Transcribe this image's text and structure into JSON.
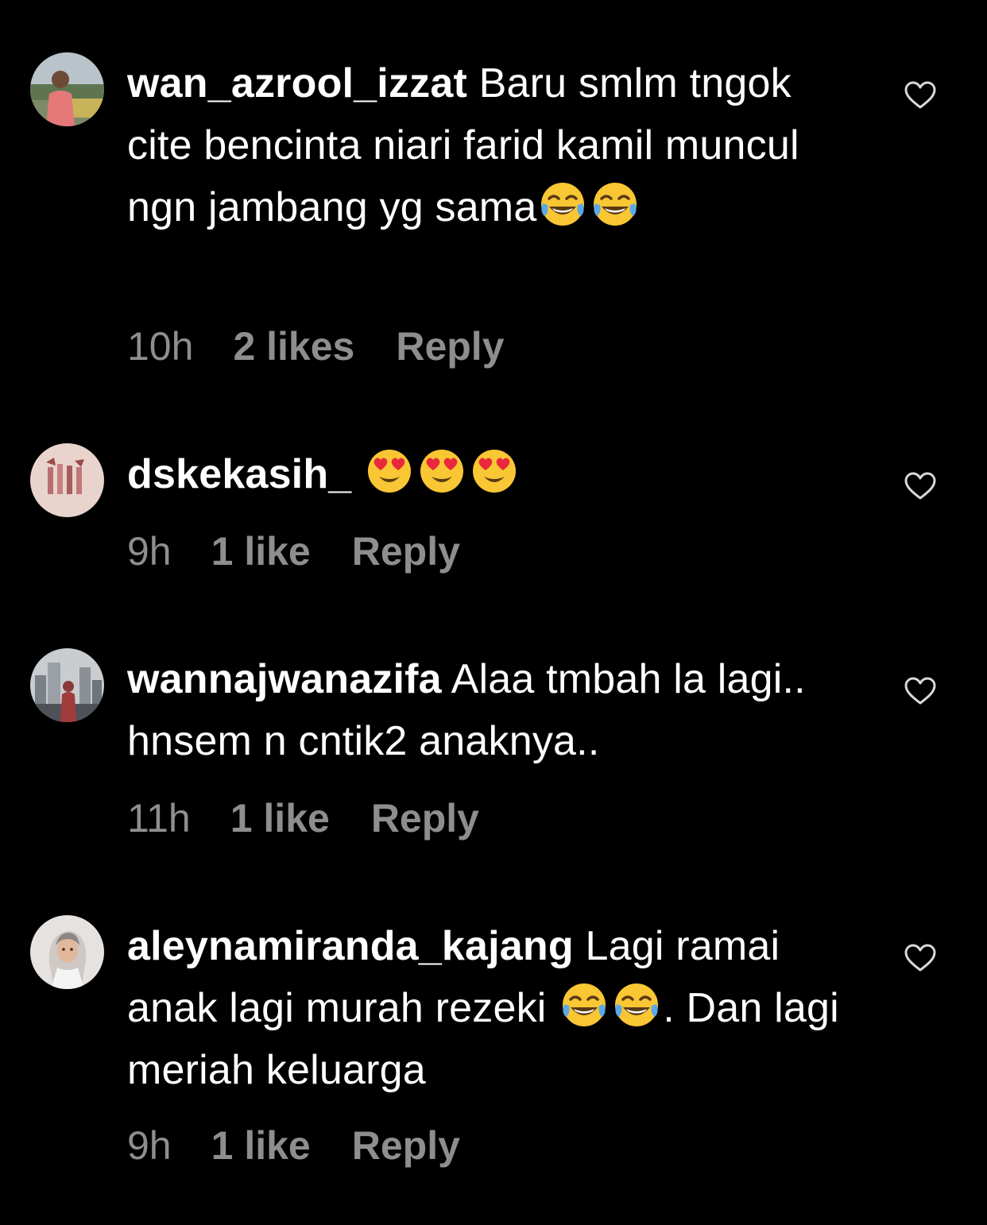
{
  "colors": {
    "background": "#000000",
    "text": "#ffffff",
    "meta_text": "#8e8e8e",
    "heart_outline": "#d8d8d8"
  },
  "comments": [
    {
      "username": "wan_azrool_izzat",
      "text_parts": [
        " Baru smlm tngok  cite bencinta niari farid kamil muncul ngn jambang yg sama"
      ],
      "emojis": [
        "face-with-tears-of-joy",
        "face-with-tears-of-joy"
      ],
      "time": "10h",
      "likes": "2 likes",
      "reply": "Reply",
      "like_icon": "heart-outline-icon"
    },
    {
      "username": "dskekasih_",
      "text_parts": [
        " "
      ],
      "emojis": [
        "smiling-face-with-heart-eyes",
        "smiling-face-with-heart-eyes",
        "smiling-face-with-heart-eyes"
      ],
      "time": "9h",
      "likes": "1 like",
      "reply": "Reply",
      "like_icon": "heart-outline-icon"
    },
    {
      "username": "wannajwanazifa",
      "text_parts": [
        " Alaa tmbah la lagi.. hnsem n cntik2 anaknya.."
      ],
      "emojis": [],
      "time": "11h",
      "likes": "1 like",
      "reply": "Reply",
      "like_icon": "heart-outline-icon"
    },
    {
      "username": "aleynamiranda_kajang",
      "text_parts": [
        " Lagi ramai anak lagi murah rezeki ",
        ". Dan lagi meriah keluarga"
      ],
      "emojis": [
        "face-with-tears-of-joy",
        "face-with-tears-of-joy"
      ],
      "time": "9h",
      "likes": "1 like",
      "reply": "Reply",
      "like_icon": "heart-outline-icon"
    }
  ]
}
